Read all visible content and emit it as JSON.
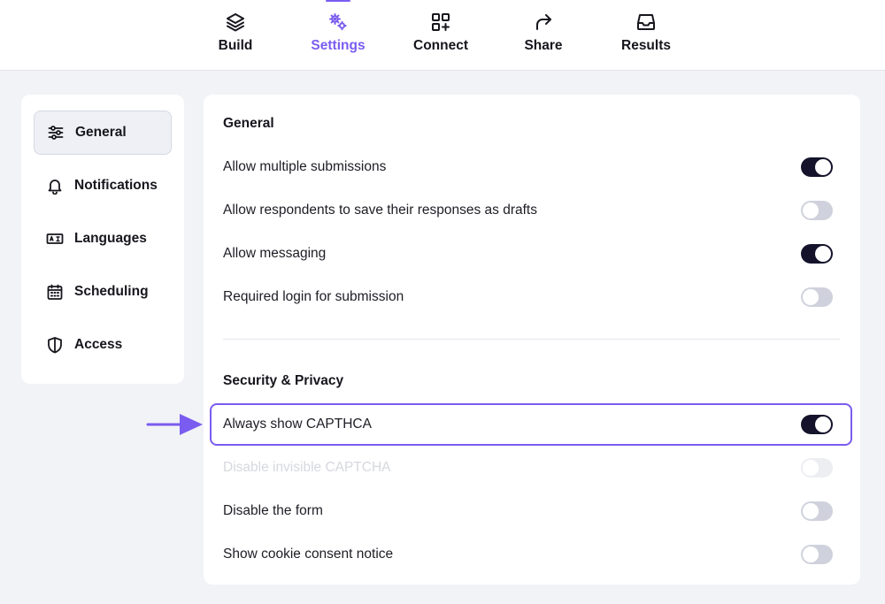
{
  "nav": {
    "tabs": [
      {
        "label": "Build",
        "icon": "layers-icon"
      },
      {
        "label": "Settings",
        "icon": "gears-icon",
        "active": true
      },
      {
        "label": "Connect",
        "icon": "grid-plus-icon"
      },
      {
        "label": "Share",
        "icon": "share-arrow-icon"
      },
      {
        "label": "Results",
        "icon": "inbox-icon"
      }
    ]
  },
  "sidebar": {
    "items": [
      {
        "label": "General",
        "icon": "sliders-icon",
        "active": true
      },
      {
        "label": "Notifications",
        "icon": "bell-icon"
      },
      {
        "label": "Languages",
        "icon": "language-icon"
      },
      {
        "label": "Scheduling",
        "icon": "calendar-icon"
      },
      {
        "label": "Access",
        "icon": "shield-icon"
      }
    ]
  },
  "general": {
    "title": "General",
    "rows": [
      {
        "label": "Allow multiple submissions",
        "enabled": true
      },
      {
        "label": "Allow respondents to save their responses as drafts",
        "enabled": false
      },
      {
        "label": "Allow messaging",
        "enabled": true
      },
      {
        "label": "Required login for submission",
        "enabled": false
      }
    ]
  },
  "security": {
    "title": "Security & Privacy",
    "rows": [
      {
        "label": "Always show CAPTHCA",
        "enabled": true,
        "highlighted": true
      },
      {
        "label": "Disable invisible CAPTCHA",
        "enabled": false,
        "disabled": true
      },
      {
        "label": "Disable the form",
        "enabled": false
      },
      {
        "label": "Show cookie consent notice",
        "enabled": false
      }
    ]
  },
  "colors": {
    "accent": "#7a5cf0",
    "toggle_on": "#14132b",
    "toggle_off": "#cfd2dc"
  }
}
